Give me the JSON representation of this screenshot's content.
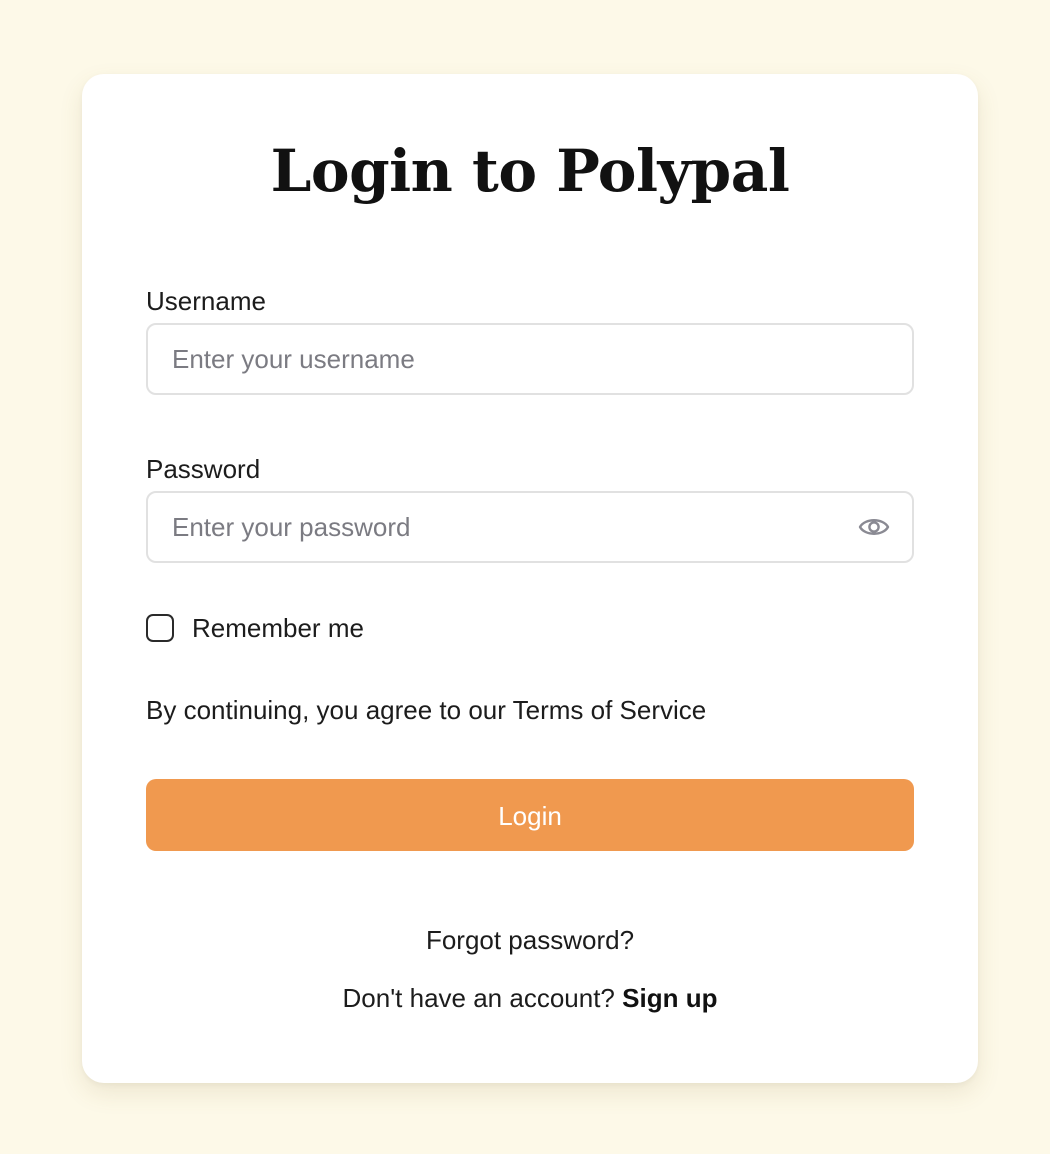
{
  "page": {
    "title": "Login to Polypal",
    "background_color": "#fdf9e8",
    "card_color": "#ffffff"
  },
  "form": {
    "username": {
      "label": "Username",
      "placeholder": "Enter your username",
      "value": ""
    },
    "password": {
      "label": "Password",
      "placeholder": "Enter your password",
      "value": "",
      "toggle_icon": "eye-icon"
    },
    "remember": {
      "label": "Remember me",
      "checked": false
    },
    "terms_text": "By continuing, you agree to our Terms of Service",
    "login_label": "Login",
    "login_color": "#f0994f"
  },
  "footer": {
    "forgot_label": "Forgot password?",
    "signup_prompt": "Don't have an account?",
    "signup_label": "Sign up"
  }
}
